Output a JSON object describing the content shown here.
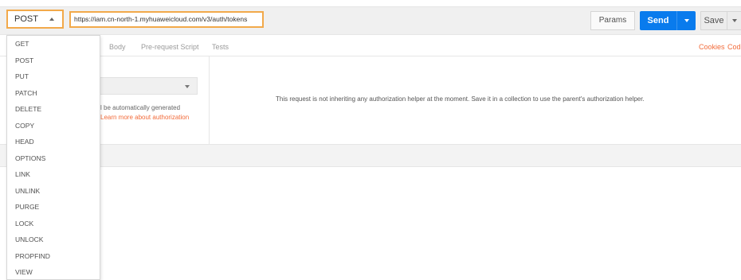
{
  "request": {
    "method": "POST",
    "url": "https://iam.cn-north-1.myhuaweicloud.com/v3/auth/tokens",
    "params_label": "Params",
    "send_label": "Send",
    "save_label": "Save"
  },
  "tabs": {
    "body": "Body",
    "prescript": "Pre-request Script",
    "tests": "Tests",
    "cookies": "Cookies",
    "code": "Cod"
  },
  "auth": {
    "help_text": "l be automatically generated",
    "link_text": "Learn more about authorization",
    "message": "This request is not inheriting any authorization helper at the moment. Save it in a collection to use the parent's authorization helper."
  },
  "methods": [
    "GET",
    "POST",
    "PUT",
    "PATCH",
    "DELETE",
    "COPY",
    "HEAD",
    "OPTIONS",
    "LINK",
    "UNLINK",
    "PURGE",
    "LOCK",
    "UNLOCK",
    "PROPFIND",
    "VIEW"
  ],
  "colors": {
    "accent": "#097bed",
    "highlight": "#f2a94a",
    "link": "#f26b3a"
  }
}
